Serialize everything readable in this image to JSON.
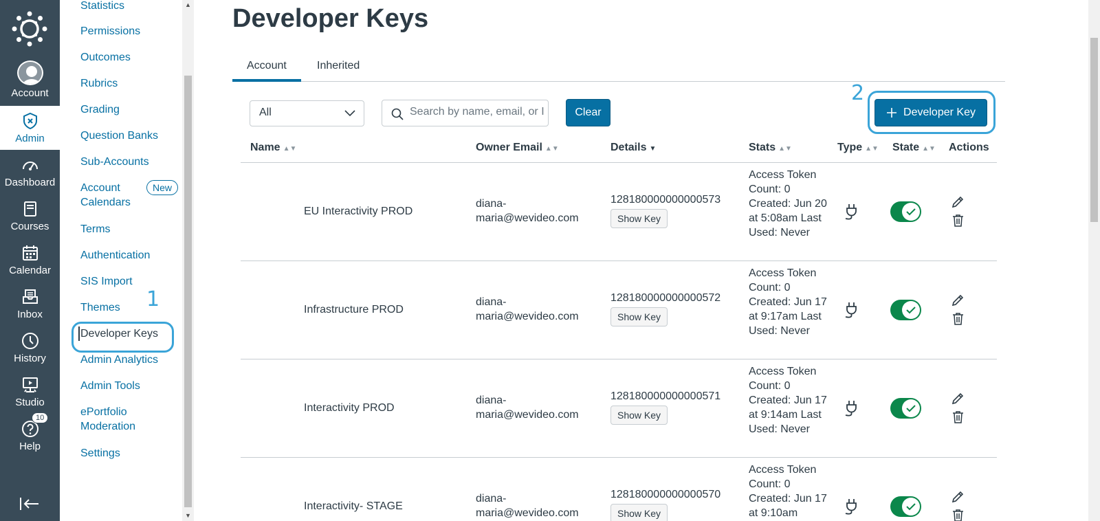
{
  "global_nav": {
    "items": [
      {
        "label": "Account",
        "icon": "user-avatar-icon"
      },
      {
        "label": "Admin",
        "icon": "shield-icon"
      },
      {
        "label": "Dashboard",
        "icon": "dashboard-icon"
      },
      {
        "label": "Courses",
        "icon": "book-icon"
      },
      {
        "label": "Calendar",
        "icon": "calendar-icon"
      },
      {
        "label": "Inbox",
        "icon": "inbox-icon"
      },
      {
        "label": "History",
        "icon": "clock-icon"
      },
      {
        "label": "Studio",
        "icon": "studio-icon"
      },
      {
        "label": "Help",
        "icon": "question-icon"
      }
    ],
    "help_badge": "10"
  },
  "sub_nav": {
    "items": [
      "Statistics",
      "Permissions",
      "Outcomes",
      "Rubrics",
      "Grading",
      "Question Banks",
      "Sub-Accounts",
      "Account Calendars",
      "Terms",
      "Authentication",
      "SIS Import",
      "Themes",
      "Developer Keys",
      "Admin Analytics",
      "Admin Tools",
      "ePortfolio Moderation",
      "Settings"
    ],
    "new_badge": "New"
  },
  "annotations": {
    "one": "1",
    "two": "2"
  },
  "page": {
    "title": "Developer Keys",
    "tabs": [
      "Account",
      "Inherited"
    ]
  },
  "filters": {
    "select_value": "All",
    "search_placeholder": "Search by name, email, or ID",
    "clear_label": "Clear",
    "add_label": "Developer Key"
  },
  "table": {
    "headers": [
      "Name",
      "Owner Email",
      "Details",
      "Stats",
      "Type",
      "State",
      "Actions"
    ],
    "show_key_label": "Show Key",
    "rows": [
      {
        "name": "EU Interactivity PROD",
        "email": "diana-maria@wevideo.com",
        "id": "128180000000000573",
        "stats": "Access Token Count: 0 Created: Jun 20 at 5:08am Last Used: Never"
      },
      {
        "name": "Infrastructure PROD",
        "email": "diana-maria@wevideo.com",
        "id": "128180000000000572",
        "stats": "Access Token Count: 0 Created: Jun 17 at 9:17am Last Used: Never"
      },
      {
        "name": "Interactivity PROD",
        "email": "diana-maria@wevideo.com",
        "id": "128180000000000571",
        "stats": "Access Token Count: 0 Created: Jun 17 at 9:14am Last Used: Never"
      },
      {
        "name": "Interactivity- STAGE",
        "email": "diana-maria@wevideo.com",
        "id": "128180000000000570",
        "stats": "Access Token Count: 0 Created: Jun 17 at 9:10am"
      }
    ]
  },
  "colors": {
    "nav_bg": "#394b58",
    "brand_blue": "#0770a3",
    "toggle_green": "#0b874b",
    "annotation": "#3aa4d8"
  }
}
